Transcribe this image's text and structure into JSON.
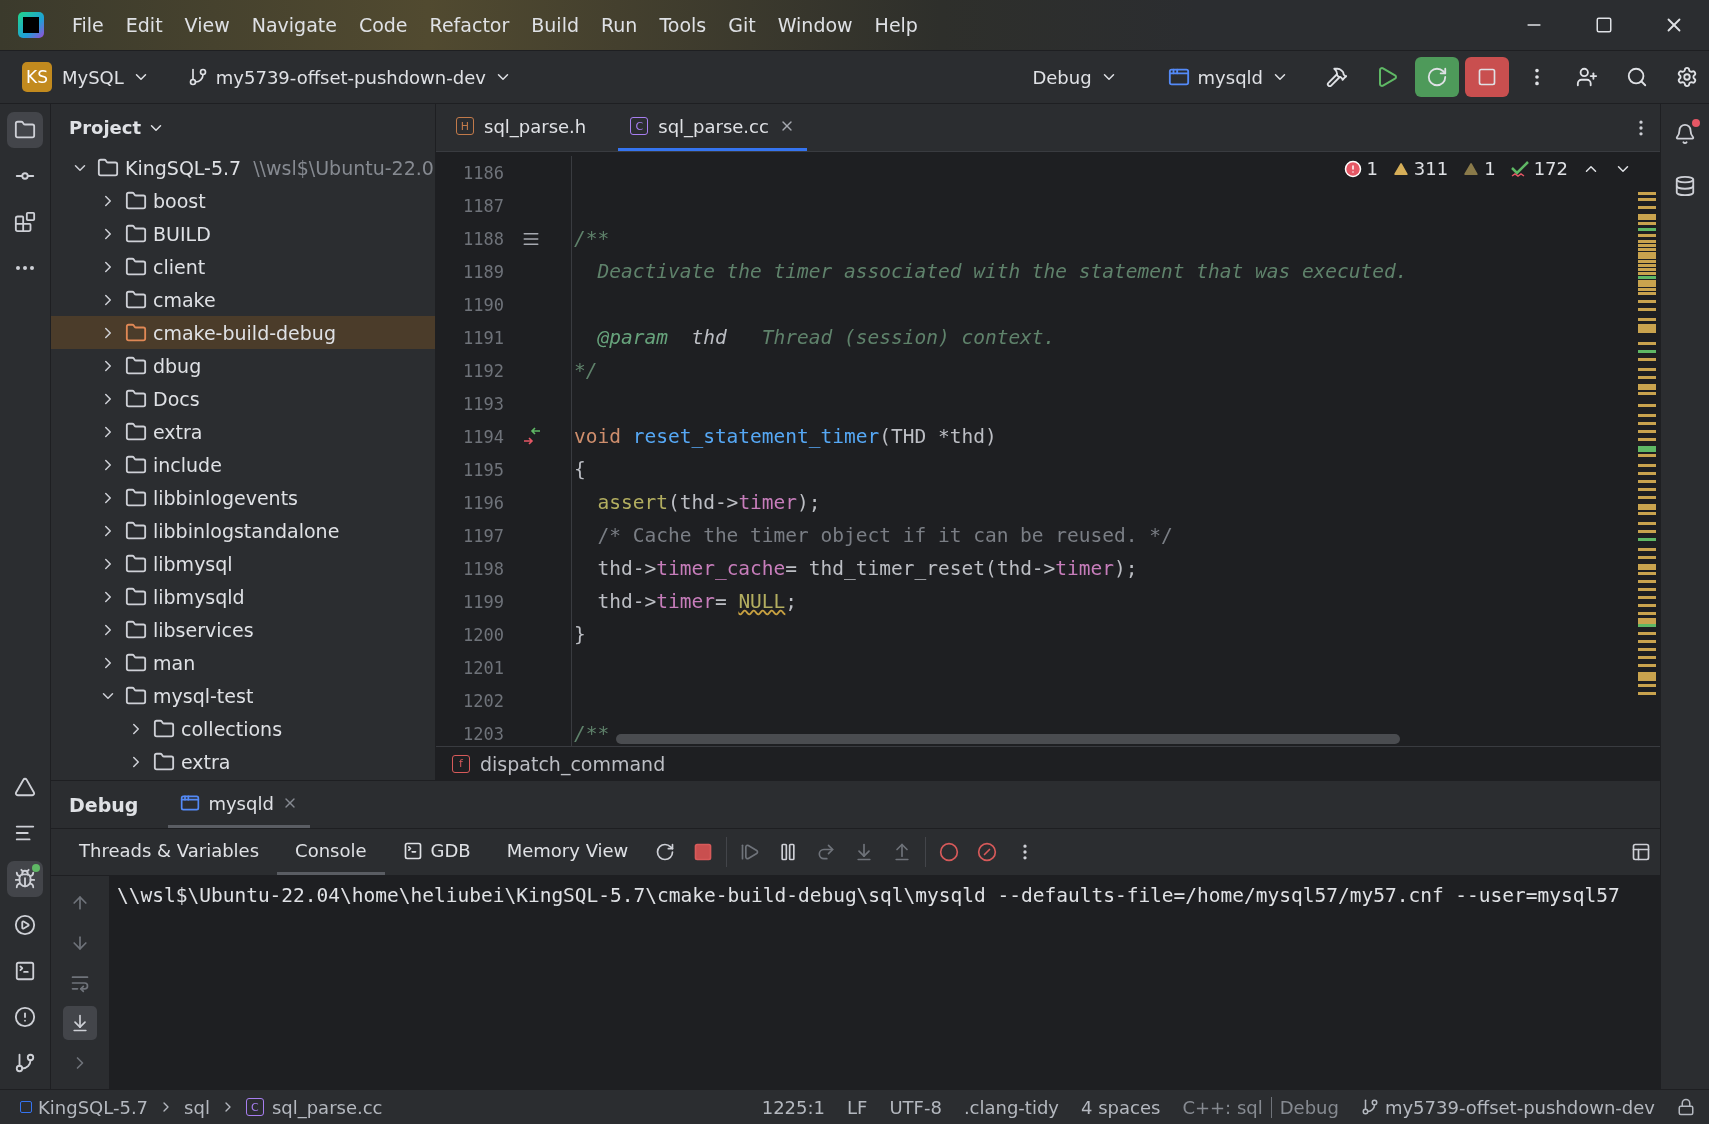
{
  "title_bar": {
    "menu": [
      "File",
      "Edit",
      "View",
      "Navigate",
      "Code",
      "Refactor",
      "Build",
      "Run",
      "Tools",
      "Git",
      "Window",
      "Help"
    ]
  },
  "toolbar": {
    "project_badge": "KS",
    "project": "MySQL",
    "branch": "my5739-offset-pushdown-dev",
    "configuration": "Debug",
    "run_target": "mysqld"
  },
  "left_tools_top": [
    {
      "kind": "project",
      "selected": true
    },
    {
      "kind": "commit",
      "selected": false
    },
    {
      "kind": "structure",
      "selected": false
    },
    {
      "kind": "more",
      "selected": false
    }
  ],
  "left_tools_bottom": [
    {
      "kind": "build",
      "selected": false
    },
    {
      "kind": "todo",
      "selected": false
    },
    {
      "kind": "debug",
      "selected": true
    },
    {
      "kind": "services",
      "selected": false
    },
    {
      "kind": "terminal",
      "selected": false
    },
    {
      "kind": "problems",
      "selected": false
    },
    {
      "kind": "git",
      "selected": false
    }
  ],
  "project_panel": {
    "title": "Project",
    "tree": [
      {
        "name": "KingSQL-5.7",
        "path": "\\\\wsl$\\Ubuntu-22.0",
        "expanded": true,
        "selected": false,
        "excluded": false,
        "children": [
          {
            "name": "boost",
            "expanded": false,
            "selected": false,
            "excluded": false
          },
          {
            "name": "BUILD",
            "expanded": false,
            "selected": false,
            "excluded": false
          },
          {
            "name": "client",
            "expanded": false,
            "selected": false,
            "excluded": false
          },
          {
            "name": "cmake",
            "expanded": false,
            "selected": false,
            "excluded": false
          },
          {
            "name": "cmake-build-debug",
            "expanded": false,
            "selected": true,
            "excluded": true
          },
          {
            "name": "dbug",
            "expanded": false,
            "selected": false,
            "excluded": false
          },
          {
            "name": "Docs",
            "expanded": false,
            "selected": false,
            "excluded": false
          },
          {
            "name": "extra",
            "expanded": false,
            "selected": false,
            "excluded": false
          },
          {
            "name": "include",
            "expanded": false,
            "selected": false,
            "excluded": false
          },
          {
            "name": "libbinlogevents",
            "expanded": false,
            "selected": false,
            "excluded": false
          },
          {
            "name": "libbinlogstandalone",
            "expanded": false,
            "selected": false,
            "excluded": false
          },
          {
            "name": "libmysql",
            "expanded": false,
            "selected": false,
            "excluded": false
          },
          {
            "name": "libmysqld",
            "expanded": false,
            "selected": false,
            "excluded": false
          },
          {
            "name": "libservices",
            "expanded": false,
            "selected": false,
            "excluded": false
          },
          {
            "name": "man",
            "expanded": false,
            "selected": false,
            "excluded": false
          },
          {
            "name": "mysql-test",
            "expanded": true,
            "selected": false,
            "excluded": false,
            "children": [
              {
                "name": "collections",
                "expanded": false,
                "selected": false,
                "excluded": false
              },
              {
                "name": "extra",
                "expanded": false,
                "selected": false,
                "excluded": false
              }
            ]
          }
        ]
      }
    ]
  },
  "editor": {
    "tabs": [
      {
        "name": "sql_parse.h",
        "kind": "header",
        "glyph": "H",
        "selected": false
      },
      {
        "name": "sql_parse.cc",
        "kind": "source",
        "glyph": "C",
        "selected": true
      }
    ],
    "inspections": [
      {
        "kind": "error",
        "count": "1"
      },
      {
        "kind": "warning",
        "count": "311"
      },
      {
        "kind": "weak",
        "count": "1"
      },
      {
        "kind": "typo",
        "count": "172"
      }
    ],
    "lines": [
      {
        "number": "1186",
        "kind": "plain"
      },
      {
        "number": "1187",
        "kind": "plain"
      },
      {
        "number": "1188",
        "kind": "doc_start",
        "tokens": [
          {
            "kind": "doc",
            "text": "/**"
          }
        ]
      },
      {
        "number": "1189",
        "kind": "plain",
        "tokens": [
          {
            "kind": "doc",
            "text": "  Deactivate the timer associated with the statement that was executed."
          }
        ]
      },
      {
        "number": "1190",
        "kind": "plain"
      },
      {
        "number": "1191",
        "kind": "plain",
        "tokens": [
          {
            "kind": "doctag",
            "text": "  @param"
          },
          {
            "kind": "docparam",
            "text": "  thd"
          },
          {
            "kind": "doc",
            "text": "   Thread (session) context."
          }
        ]
      },
      {
        "number": "1192",
        "kind": "plain",
        "tokens": [
          {
            "kind": "doc",
            "text": "*/"
          }
        ]
      },
      {
        "number": "1193",
        "kind": "plain"
      },
      {
        "number": "1194",
        "kind": "override",
        "tokens": [
          {
            "kind": "keyword",
            "text": "void "
          },
          {
            "kind": "function",
            "text": "reset_statement_timer"
          },
          {
            "kind": "plain",
            "text": "(THD *thd)"
          }
        ]
      },
      {
        "number": "1195",
        "kind": "plain",
        "tokens": [
          {
            "kind": "plain",
            "text": "{"
          }
        ]
      },
      {
        "number": "1196",
        "kind": "plain",
        "tokens": [
          {
            "kind": "macro",
            "text": "  assert"
          },
          {
            "kind": "plain",
            "text": "(thd->"
          },
          {
            "kind": "field",
            "text": "timer"
          },
          {
            "kind": "plain",
            "text": ");"
          }
        ]
      },
      {
        "number": "1197",
        "kind": "plain",
        "tokens": [
          {
            "kind": "comment",
            "text": "  /* Cache the timer object if it can be reused. */"
          }
        ]
      },
      {
        "number": "1198",
        "kind": "plain",
        "tokens": [
          {
            "kind": "plain",
            "text": "  thd->"
          },
          {
            "kind": "field",
            "text": "timer_cache"
          },
          {
            "kind": "plain",
            "text": "= thd_timer_reset(thd->"
          },
          {
            "kind": "field",
            "text": "timer"
          },
          {
            "kind": "plain",
            "text": ");"
          }
        ]
      },
      {
        "number": "1199",
        "kind": "plain",
        "tokens": [
          {
            "kind": "plain",
            "text": "  thd->"
          },
          {
            "kind": "field",
            "text": "timer"
          },
          {
            "kind": "plain",
            "text": "= "
          },
          {
            "kind": "macro_warn",
            "text": "NULL"
          },
          {
            "kind": "plain",
            "text": ";"
          }
        ]
      },
      {
        "number": "1200",
        "kind": "plain",
        "tokens": [
          {
            "kind": "plain",
            "text": "}"
          }
        ]
      },
      {
        "number": "1201",
        "kind": "plain"
      },
      {
        "number": "1202",
        "kind": "plain"
      },
      {
        "number": "1203",
        "kind": "plain",
        "tokens": [
          {
            "kind": "doc",
            "text": "/**"
          }
        ]
      }
    ],
    "breadcrumb": {
      "glyph": "f",
      "text": "dispatch_command"
    }
  },
  "debug": {
    "title": "Debug",
    "session": "mysqld",
    "tabs": [
      {
        "label": "Threads & Variables",
        "kind": "text",
        "selected": false
      },
      {
        "label": "Console",
        "kind": "text",
        "selected": true
      },
      {
        "label": "GDB",
        "kind": "terminal",
        "selected": false
      },
      {
        "label": "Memory View",
        "kind": "text",
        "selected": false
      }
    ],
    "side_tools": [
      {
        "kind": "up",
        "selected": false
      },
      {
        "kind": "down",
        "selected": false
      },
      {
        "kind": "wrap",
        "selected": false
      },
      {
        "kind": "scroll_end",
        "selected": true
      },
      {
        "kind": "more",
        "selected": false
      }
    ],
    "console": "\\\\wsl$\\Ubuntu-22.04\\home\\heliubei\\KingSQL-5.7\\cmake-build-debug\\sql\\mysqld --defaults-file=/home/mysql57/my57.cnf --user=mysql57"
  },
  "status_bar": {
    "path": [
      "KingSQL-5.7",
      "sql",
      "sql_parse.cc"
    ],
    "file_glyph": "C",
    "position": "1225:1",
    "line_sep": "LF",
    "encoding": "UTF-8",
    "config": ".clang-tidy",
    "indent": "4 spaces",
    "context": "C++: sql",
    "build": "Debug",
    "branch": "my5739-offset-pushdown-dev"
  }
}
